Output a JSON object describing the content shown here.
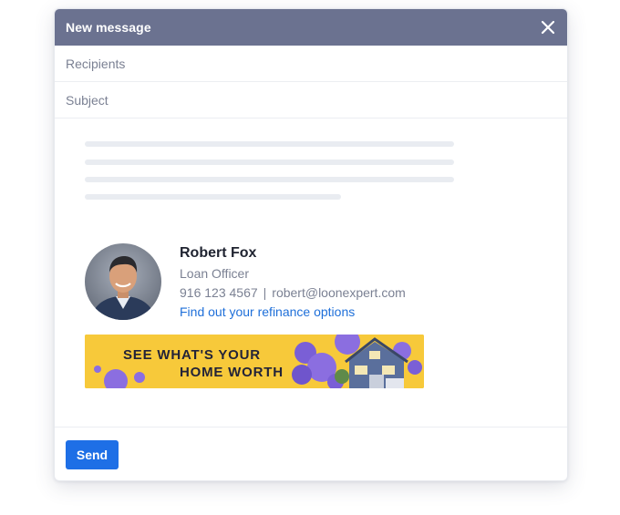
{
  "window": {
    "title": "New message"
  },
  "fields": {
    "recipients_placeholder": "Recipients",
    "subject_placeholder": "Subject"
  },
  "signature": {
    "name": "Robert Fox",
    "job_title": "Loan Officer",
    "phone": "916 123 4567",
    "separator": "|",
    "email": "robert@loonexpert.com",
    "link_text": "Find out your refinance options"
  },
  "banner": {
    "line1": "SEE WHAT'S YOUR",
    "line2": "HOME WORTH"
  },
  "footer": {
    "send_label": "Send"
  },
  "colors": {
    "titlebar": "#6b7290",
    "accent": "#1e6fe6",
    "link": "#1e6fd9",
    "banner_bg": "#f7c93a",
    "banner_blob": "#8b6ee0"
  }
}
